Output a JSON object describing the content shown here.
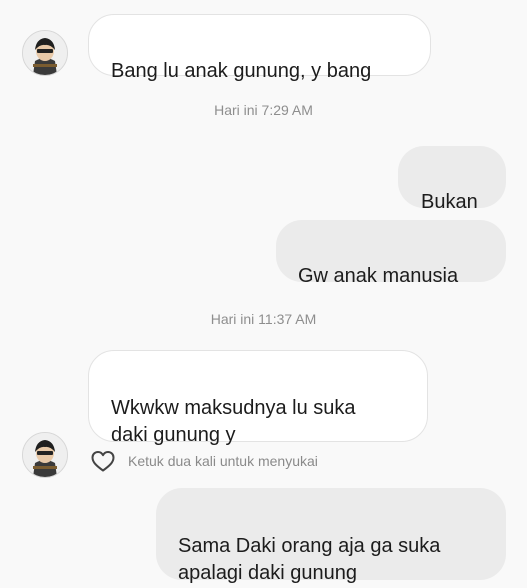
{
  "conversation": {
    "messages": [
      {
        "side": "incoming",
        "text": "Bang lu anak gunung, y bang"
      },
      {
        "side": "outgoing",
        "text": "Bukan"
      },
      {
        "side": "outgoing",
        "text": "Gw anak manusia"
      },
      {
        "side": "incoming",
        "text": "Wkwkw maksudnya lu suka\ndaki gunung y"
      },
      {
        "side": "outgoing",
        "text": "Sama Daki orang aja ga suka\napalagi daki gunung"
      }
    ],
    "timestamps": [
      "Hari ini 7:29 AM",
      "Hari ini 11:37 AM"
    ],
    "like_hint": "Ketuk dua kali untuk menyukai"
  },
  "icons": {
    "avatar": "avatar-icon",
    "like": "heart-outline-icon"
  },
  "colors": {
    "background": "#f9f9f9",
    "incoming_bubble": "#ffffff",
    "outgoing_bubble": "#ebebeb",
    "secondary_text": "#8e8e8e"
  }
}
